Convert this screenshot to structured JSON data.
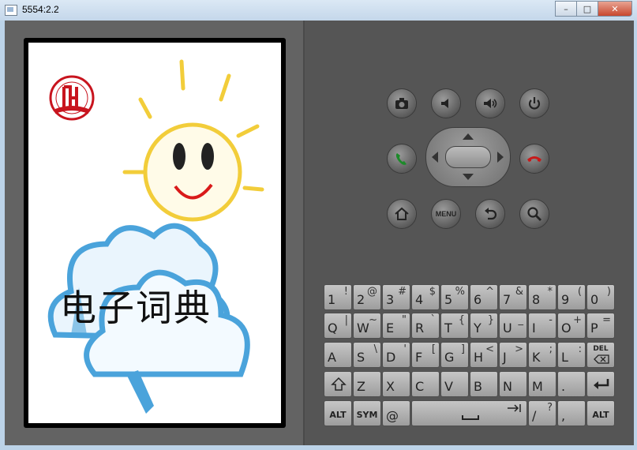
{
  "window": {
    "title": "5554:2.2",
    "minimize": "–",
    "restore": "□",
    "close": "✕"
  },
  "app": {
    "title": "电子词典"
  },
  "hardware": {
    "menu_label": "MENU"
  },
  "keyboard": {
    "row1": [
      {
        "main": "1",
        "alt": "!"
      },
      {
        "main": "2",
        "alt": "@"
      },
      {
        "main": "3",
        "alt": "#"
      },
      {
        "main": "4",
        "alt": "$"
      },
      {
        "main": "5",
        "alt": "%"
      },
      {
        "main": "6",
        "alt": "^"
      },
      {
        "main": "7",
        "alt": "&"
      },
      {
        "main": "8",
        "alt": "*"
      },
      {
        "main": "9",
        "alt": "("
      },
      {
        "main": "0",
        "alt": ")"
      }
    ],
    "row2": [
      {
        "main": "Q",
        "alt": "|"
      },
      {
        "main": "W",
        "alt": "~"
      },
      {
        "main": "E",
        "alt": "\""
      },
      {
        "main": "R",
        "alt": "`"
      },
      {
        "main": "T",
        "alt": "{"
      },
      {
        "main": "Y",
        "alt": "}"
      },
      {
        "main": "U",
        "alt": "_"
      },
      {
        "main": "I",
        "alt": "-"
      },
      {
        "main": "O",
        "alt": "+"
      },
      {
        "main": "P",
        "alt": "="
      }
    ],
    "row3": [
      {
        "main": "A",
        "alt": ""
      },
      {
        "main": "S",
        "alt": "\\"
      },
      {
        "main": "D",
        "alt": "'"
      },
      {
        "main": "F",
        "alt": "["
      },
      {
        "main": "G",
        "alt": "]"
      },
      {
        "main": "H",
        "alt": "<"
      },
      {
        "main": "J",
        "alt": ">"
      },
      {
        "main": "K",
        "alt": ";"
      },
      {
        "main": "L",
        "alt": ":"
      }
    ],
    "del_label": "DEL",
    "row4": [
      {
        "main": "Z",
        "alt": ""
      },
      {
        "main": "X",
        "alt": ""
      },
      {
        "main": "C",
        "alt": ""
      },
      {
        "main": "V",
        "alt": ""
      },
      {
        "main": "B",
        "alt": ""
      },
      {
        "main": "N",
        "alt": ""
      },
      {
        "main": "M",
        "alt": ""
      },
      {
        "main": ".",
        "alt": ""
      }
    ],
    "alt_left": "ALT",
    "sym": "SYM",
    "at": "@",
    "slash": {
      "main": "/",
      "alt": "?"
    },
    "comma": {
      "main": ",",
      "alt": ""
    },
    "alt_right": "ALT"
  }
}
